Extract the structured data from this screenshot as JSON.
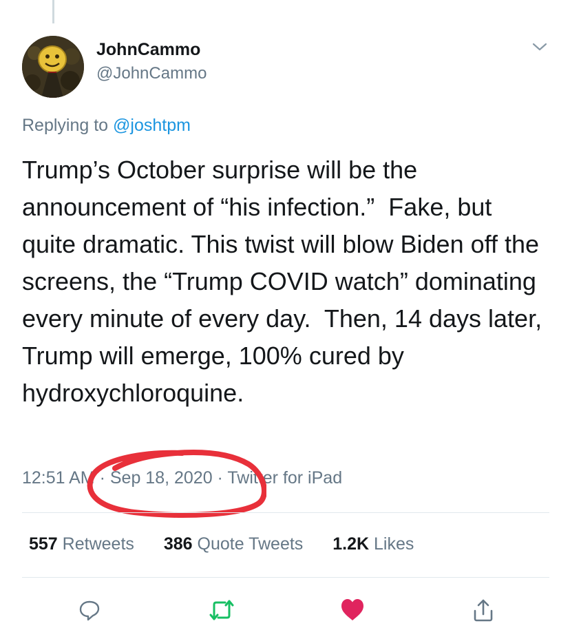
{
  "author": {
    "display_name": "JohnCammo",
    "handle": "@JohnCammo"
  },
  "reply": {
    "prefix": "Replying to ",
    "handle": "@joshtpm"
  },
  "tweet": {
    "text": "Trump’s October surprise will be the announcement of “his infection.”  Fake, but quite dramatic. This twist will blow Biden off the screens, the “Trump COVID watch” dominating every minute of every day.  Then, 14 days later, Trump will emerge, 100% cured by hydroxychloroquine.",
    "time": "12:51 AM",
    "separator": " · ",
    "date": "Sep 18, 2020",
    "source": "Twitter for iPad"
  },
  "stats": {
    "retweets_count": "557",
    "retweets_label": "Retweets",
    "quotes_count": "386",
    "quotes_label": "Quote Tweets",
    "likes_count": "1.2K",
    "likes_label": "Likes"
  },
  "actions": {
    "reply_icon": "reply-icon",
    "retweet_icon": "retweet-icon",
    "like_icon": "heart-icon",
    "share_icon": "share-icon"
  },
  "colors": {
    "text": "#14171a",
    "secondary": "#657786",
    "link": "#1b95e0",
    "retweet": "#17bf63",
    "like": "#e0245e",
    "annotation": "#e8303a"
  }
}
